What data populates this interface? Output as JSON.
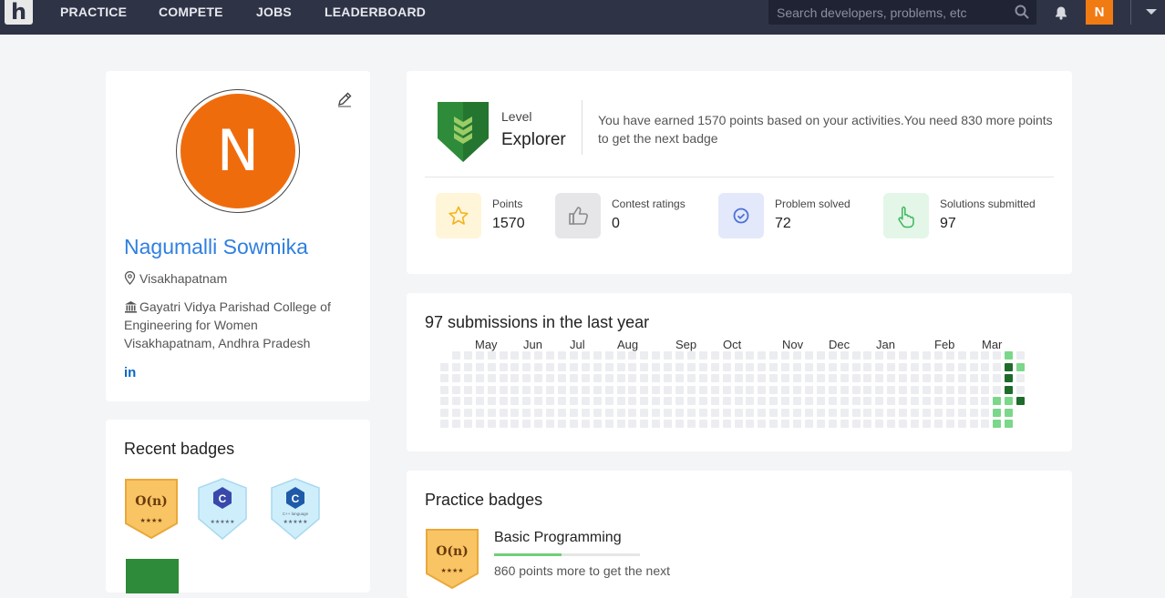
{
  "nav": {
    "logo": "h",
    "links": [
      "PRACTICE",
      "COMPETE",
      "JOBS",
      "LEADERBOARD"
    ],
    "search_placeholder": "Search developers, problems, etc",
    "avatar_letter": "N"
  },
  "profile": {
    "avatar_letter": "N",
    "name": "Nagumalli Sowmika",
    "location": "Visakhapatnam",
    "college": "Gayatri Vidya Parishad College of Engineering for Women Visakhapatnam, Andhra Pradesh",
    "social": "in"
  },
  "recent_badges": {
    "title": "Recent badges",
    "badges": [
      {
        "label": "O(n)",
        "type": "gold"
      },
      {
        "label": "C",
        "type": "blue"
      },
      {
        "label": "C++ language",
        "type": "blue"
      }
    ]
  },
  "level": {
    "label": "Level",
    "name": "Explorer",
    "message": "You have earned 1570 points based on your activities.You need 830 more points to get the next badge"
  },
  "stats": [
    {
      "label": "Points",
      "value": "1570",
      "icon": "star-icon",
      "bg": "#fff5d9",
      "fg": "#f2b321"
    },
    {
      "label": "Contest ratings",
      "value": "0",
      "icon": "thumbs-up-icon",
      "bg": "#e6e6e8",
      "fg": "#8a8a8a"
    },
    {
      "label": "Problem solved",
      "value": "72",
      "icon": "check-circle-icon",
      "bg": "#e3e9fb",
      "fg": "#4d72d8"
    },
    {
      "label": "Solutions submitted",
      "value": "97",
      "icon": "hand-pointer-icon",
      "bg": "#e3f6e8",
      "fg": "#3fb65d"
    }
  ],
  "submissions": {
    "title": "97 submissions in the last year",
    "months": [
      "May",
      "Jun",
      "Jul",
      "Aug",
      "Sep",
      "Oct",
      "Nov",
      "Dec",
      "Jan",
      "Feb",
      "Mar"
    ],
    "colors": {
      "empty": "#ebedf0",
      "light": "#7bd78a",
      "dark": "#1e6b2c"
    }
  },
  "practice": {
    "title": "Practice badges",
    "badge": {
      "label": "O(n)",
      "name": "Basic Programming",
      "progress": 0.46,
      "note": "860 points more to get the next"
    }
  }
}
